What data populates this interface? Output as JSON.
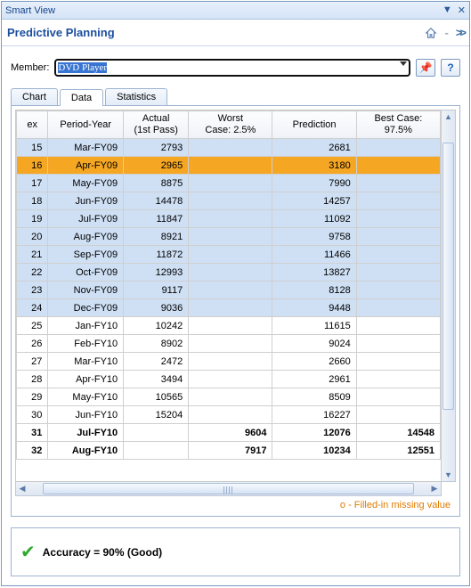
{
  "title": "Smart View",
  "subtitle": "Predictive Planning",
  "member": {
    "label": "Member:",
    "value": "DVD Player"
  },
  "tabs": {
    "chart": "Chart",
    "data": "Data",
    "stats": "Statistics",
    "active": "data"
  },
  "columns": {
    "ex": "ex",
    "period": "Period-Year",
    "actual": "Actual\n(1st Pass)",
    "worst": "Worst\nCase: 2.5%",
    "prediction": "Prediction",
    "best": "Best Case:\n97.5%"
  },
  "rows": [
    {
      "ex": "15",
      "period": "Mar-FY09",
      "actual": "2793",
      "worst": "",
      "pred": "2681",
      "best": "",
      "style": "shaded"
    },
    {
      "ex": "16",
      "period": "Apr-FY09",
      "actual": "2965",
      "worst": "",
      "pred": "3180",
      "best": "",
      "style": "highlight"
    },
    {
      "ex": "17",
      "period": "May-FY09",
      "actual": "8875",
      "worst": "",
      "pred": "7990",
      "best": "",
      "style": "shaded"
    },
    {
      "ex": "18",
      "period": "Jun-FY09",
      "actual": "14478",
      "worst": "",
      "pred": "14257",
      "best": "",
      "style": "shaded"
    },
    {
      "ex": "19",
      "period": "Jul-FY09",
      "actual": "11847",
      "worst": "",
      "pred": "11092",
      "best": "",
      "style": "shaded"
    },
    {
      "ex": "20",
      "period": "Aug-FY09",
      "actual": "8921",
      "worst": "",
      "pred": "9758",
      "best": "",
      "style": "shaded"
    },
    {
      "ex": "21",
      "period": "Sep-FY09",
      "actual": "11872",
      "worst": "",
      "pred": "11466",
      "best": "",
      "style": "shaded"
    },
    {
      "ex": "22",
      "period": "Oct-FY09",
      "actual": "12993",
      "worst": "",
      "pred": "13827",
      "best": "",
      "style": "shaded"
    },
    {
      "ex": "23",
      "period": "Nov-FY09",
      "actual": "9117",
      "worst": "",
      "pred": "8128",
      "best": "",
      "style": "shaded"
    },
    {
      "ex": "24",
      "period": "Dec-FY09",
      "actual": "9036",
      "worst": "",
      "pred": "9448",
      "best": "",
      "style": "shaded"
    },
    {
      "ex": "25",
      "period": "Jan-FY10",
      "actual": "10242",
      "worst": "",
      "pred": "11615",
      "best": "",
      "style": ""
    },
    {
      "ex": "26",
      "period": "Feb-FY10",
      "actual": "8902",
      "worst": "",
      "pred": "9024",
      "best": "",
      "style": ""
    },
    {
      "ex": "27",
      "period": "Mar-FY10",
      "actual": "2472",
      "worst": "",
      "pred": "2660",
      "best": "",
      "style": ""
    },
    {
      "ex": "28",
      "period": "Apr-FY10",
      "actual": "3494",
      "worst": "",
      "pred": "2961",
      "best": "",
      "style": ""
    },
    {
      "ex": "29",
      "period": "May-FY10",
      "actual": "10565",
      "worst": "",
      "pred": "8509",
      "best": "",
      "style": ""
    },
    {
      "ex": "30",
      "period": "Jun-FY10",
      "actual": "15204",
      "worst": "",
      "pred": "16227",
      "best": "",
      "style": ""
    },
    {
      "ex": "31",
      "period": "Jul-FY10",
      "actual": "",
      "worst": "9604",
      "pred": "12076",
      "best": "14548",
      "style": "bold"
    },
    {
      "ex": "32",
      "period": "Aug-FY10",
      "actual": "",
      "worst": "7917",
      "pred": "10234",
      "best": "12551",
      "style": "bold"
    }
  ],
  "legend": "o - Filled-in missing value",
  "accuracy": "Accuracy = 90% (Good)"
}
